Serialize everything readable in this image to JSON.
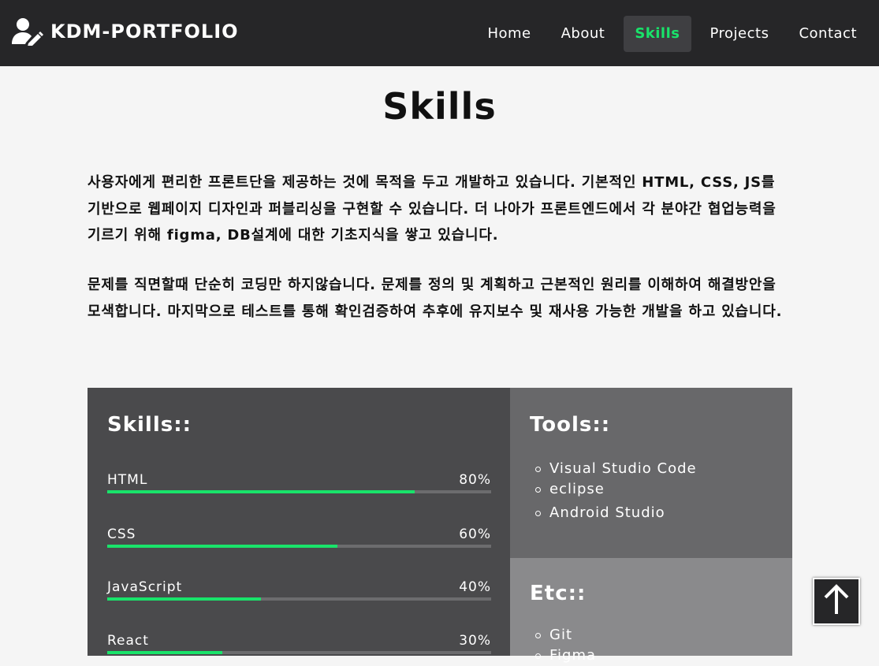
{
  "header": {
    "brand": "KDM-PORTFOLIO",
    "brand_icon": "user-pen-icon",
    "nav": [
      {
        "label": "Home",
        "active": false
      },
      {
        "label": "About",
        "active": false
      },
      {
        "label": "Skills",
        "active": true
      },
      {
        "label": "Projects",
        "active": false
      },
      {
        "label": "Contact",
        "active": false
      }
    ]
  },
  "main": {
    "title": "Skills",
    "paragraphs": [
      "사용자에게 편리한 프론트단을 제공하는 것에 목적을 두고 개발하고 있습니다. 기본적인 HTML, CSS, JS를 기반으로 웹페이지 디자인과 퍼블리싱을 구현할 수 있습니다. 더 나아가 프론트엔드에서 각 분야간 협업능력을 기르기 위해 figma, DB설계에 대한 기초지식을 쌓고 있습니다.",
      "문제를 직면할때 단순히 코딩만 하지않습니다. 문제를 정의 및 계획하고 근본적인 원리를 이해하여 해결방안을 모색합니다. 마지막으로 테스트를 통해 확인검증하여 추후에 유지보수 및 재사용 가능한 개발을 하고 있습니다."
    ]
  },
  "skills": {
    "title": "Skills::",
    "items": [
      {
        "name": "HTML",
        "percent_label": "80%",
        "percent": 80
      },
      {
        "name": "CSS",
        "percent_label": "60%",
        "percent": 60
      },
      {
        "name": "JavaScript",
        "percent_label": "40%",
        "percent": 40
      },
      {
        "name": "React",
        "percent_label": "30%",
        "percent": 30
      }
    ]
  },
  "tools": {
    "title": "Tools::",
    "items": [
      "Visual Studio Code",
      "eclipse",
      "Android Studio"
    ]
  },
  "etc": {
    "title": "Etc::",
    "items": [
      "Git",
      "Figma"
    ]
  },
  "scroll_top": {
    "icon": "arrow-up-icon"
  },
  "colors": {
    "accent": "#19e36a",
    "navbar_bg": "#262628",
    "skills_bg": "#4a4a4c",
    "tools_bg": "#68686a",
    "etc_bg": "#8a8a8c",
    "page_bg": "#f5f5f5"
  }
}
